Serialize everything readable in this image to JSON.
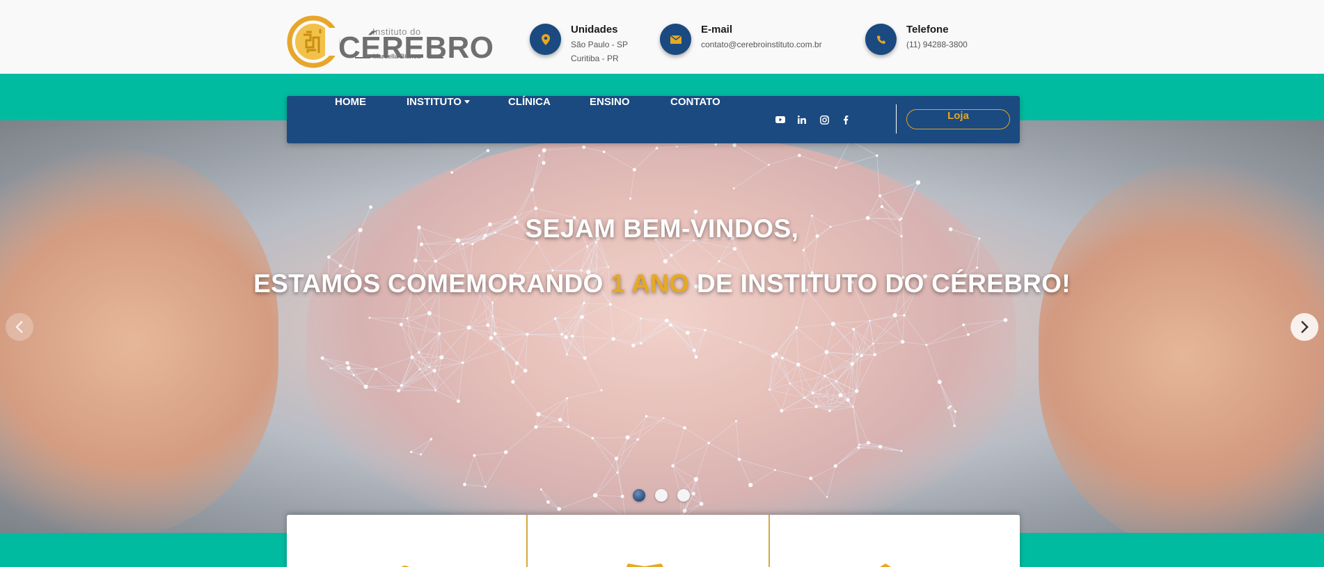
{
  "header": {
    "logo": {
      "small_text": "Instituto do",
      "big_text": "CÉREBRO",
      "sub_text": "Marcella Bianca"
    },
    "contacts": [
      {
        "icon": "map-marker-icon",
        "title": "Unidades",
        "lines": [
          "São Paulo - SP",
          "Curitiba - PR"
        ]
      },
      {
        "icon": "envelope-icon",
        "title": "E-mail",
        "lines": [
          "contato@cerebroinstituto.com.br"
        ]
      },
      {
        "icon": "phone-icon",
        "title": "Telefone",
        "lines": [
          "(11) 94288-3800"
        ]
      }
    ]
  },
  "nav": {
    "items": [
      "HOME",
      "INSTITUTO",
      "CLÍNICA",
      "ENSINO",
      "CONTATO"
    ],
    "social": [
      "youtube-icon",
      "linkedin-icon",
      "instagram-icon",
      "facebook-icon"
    ],
    "shop_label": "Loja"
  },
  "hero": {
    "line1": "SEJAM BEM-VINDOS,",
    "line2_before": "ESTAMOS COMEMORANDO ",
    "line2_accent": "1 ANO",
    "line2_after": " DE INSTITUTO DO CÉREBRO!",
    "slides_count": 3,
    "active_slide": 1
  },
  "colors": {
    "navy": "#1b4a80",
    "teal": "#00bba0",
    "gold": "#e8a820"
  }
}
